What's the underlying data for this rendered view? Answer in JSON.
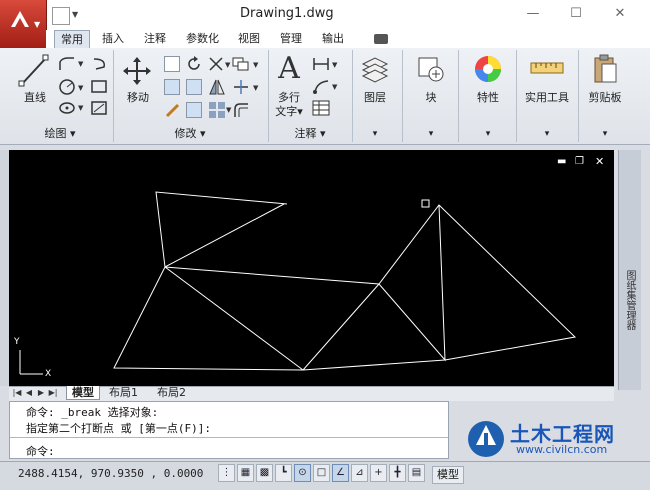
{
  "window": {
    "title": "Drawing1.dwg",
    "controls": {
      "minimize": "—",
      "maximize": "☐",
      "close": "✕"
    }
  },
  "ribbon_tabs": [
    "常用",
    "插入",
    "注释",
    "参数化",
    "视图",
    "管理",
    "输出"
  ],
  "ribbon_extra_tab_icon": "tab-overflow-icon",
  "panels": {
    "draw": {
      "title": "绘图 ▾",
      "line_label": "直线"
    },
    "modify": {
      "title": "修改 ▾",
      "move_label": "移动"
    },
    "annotation": {
      "title": "注释 ▾",
      "mtext_label_1": "多行",
      "mtext_label_2": "文字▾",
      "text_glyph": "A"
    },
    "layer": {
      "label": "图层",
      "arrow": "▾"
    },
    "block": {
      "label": "块",
      "arrow": "▾"
    },
    "properties": {
      "label": "特性",
      "arrow": "▾"
    },
    "utilities": {
      "label": "实用工具",
      "arrow": "▾"
    },
    "clipboard": {
      "label": "剪贴板",
      "arrow": "▾"
    }
  },
  "viewport_controls": {
    "minimize": "▬",
    "restore": "❐",
    "close": "✕"
  },
  "ucs": {
    "y": "Y",
    "x": "X"
  },
  "side_palette": {
    "label": "图纸集管理器"
  },
  "layout_tabs": {
    "nav": [
      "|◀",
      "◀",
      "▶",
      "▶|"
    ],
    "tabs": [
      "模型",
      "布局1",
      "布局2"
    ]
  },
  "command": {
    "line1": "命令:  _break 选择对象:",
    "line2": "指定第二个打断点 或 [第一点(F)]:",
    "prompt": "命令:"
  },
  "status": {
    "coordinates": "2488.4154, 970.9350 , 0.0000",
    "mode_label": "模型"
  },
  "watermark": {
    "brand": "土木工程网",
    "url": "www.civilcn.com"
  },
  "colors": {
    "app_red": "#c0322a",
    "canvas_bg": "#000000",
    "line": "#ffffff"
  }
}
